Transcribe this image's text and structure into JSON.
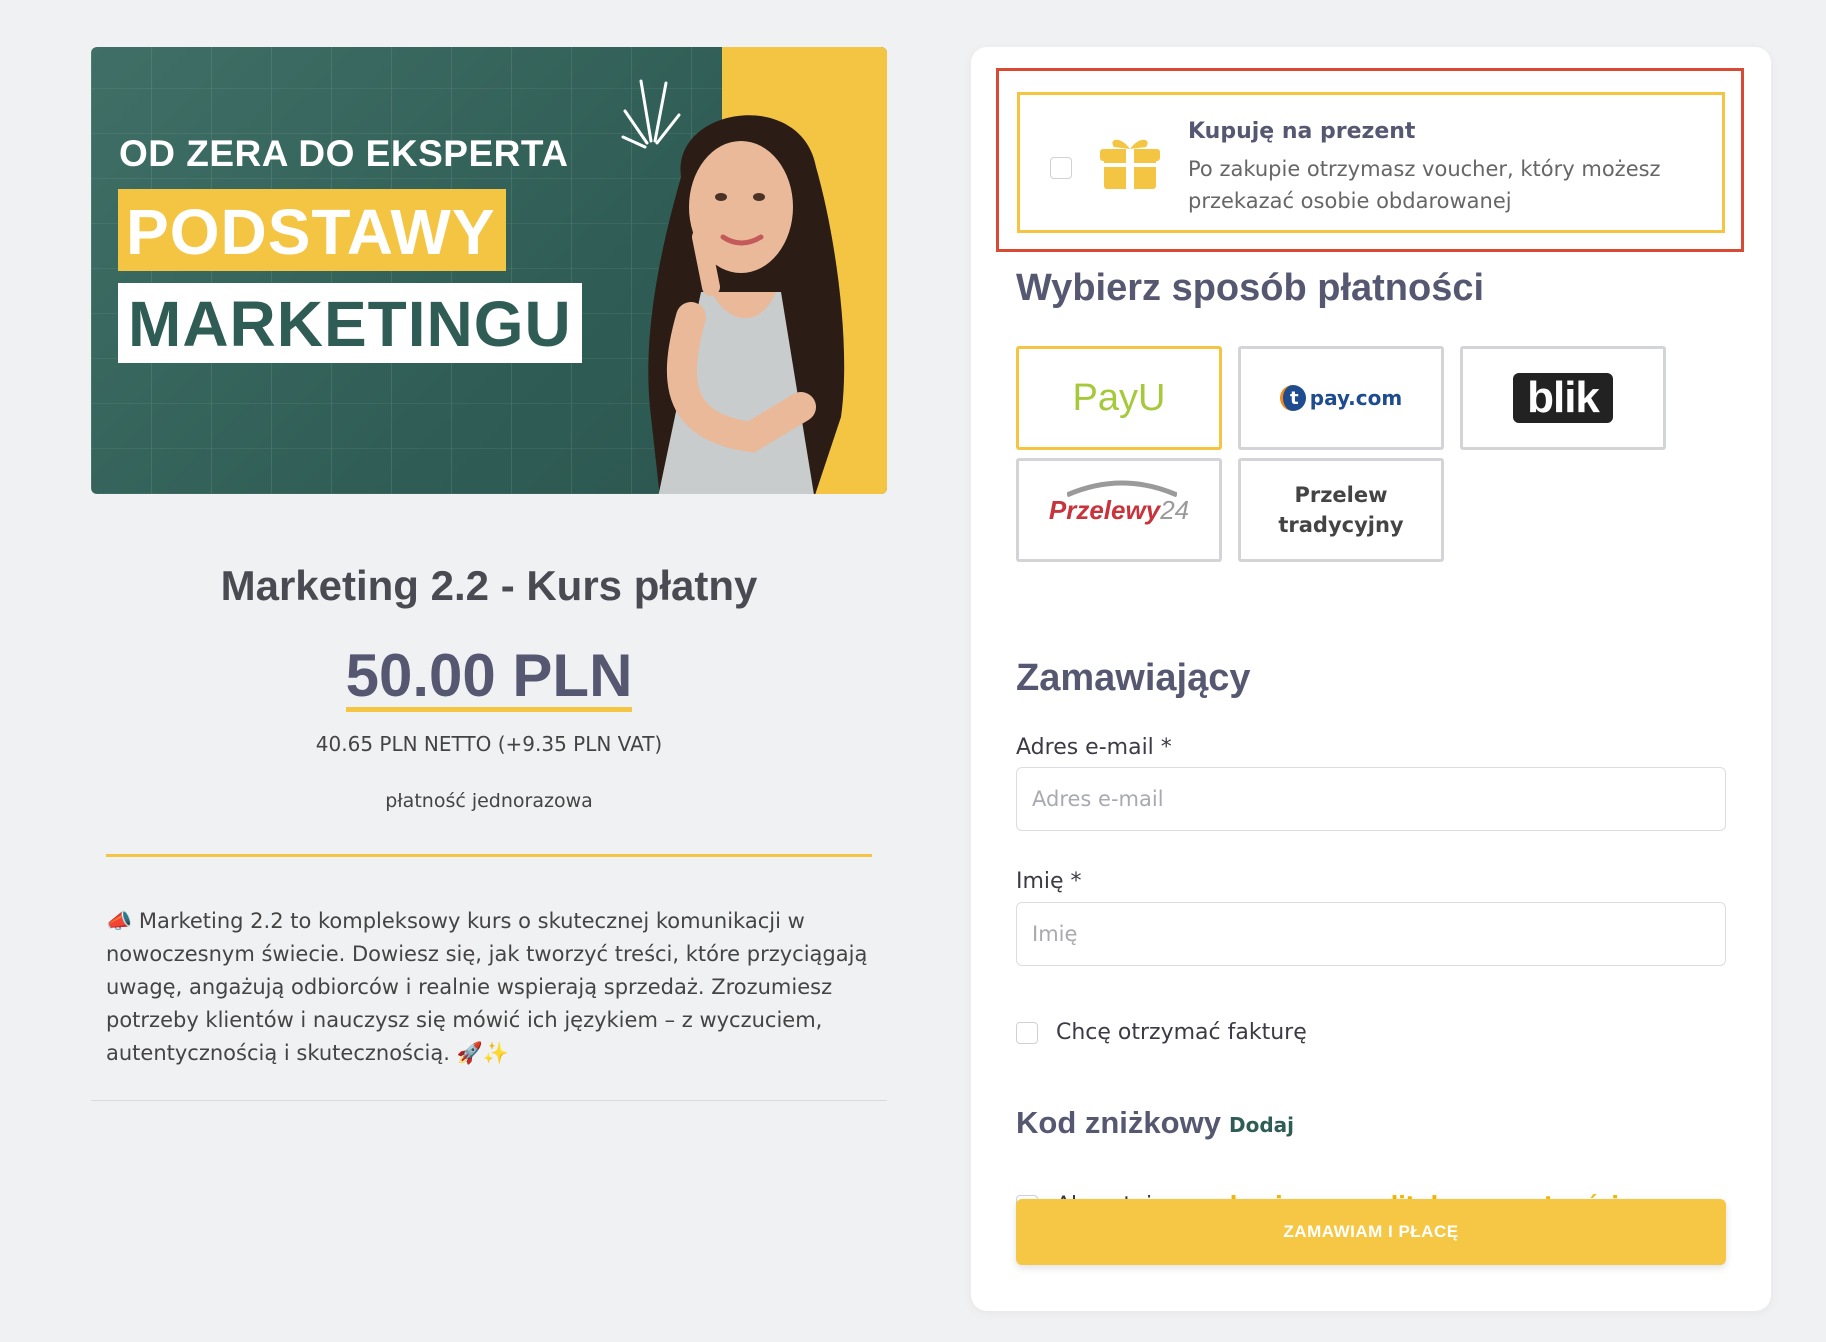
{
  "banner": {
    "kicker": "OD ZERA DO EKSPERTA",
    "title_line1": "PODSTAWY",
    "title_line2": "MARKETINGU"
  },
  "course": {
    "title": "Marketing 2.2 - Kurs płatny",
    "price": "50.00 PLN",
    "netto": "40.65 PLN NETTO (+9.35 PLN VAT)",
    "payment_type": "płatność jednorazowa",
    "description_icon": "📣",
    "description": "Marketing 2.2 to kompleksowy kurs o skutecznej komunikacji w nowoczesnym świecie. Dowiesz się, jak tworzyć treści, które przyciągają uwagę, angażują odbiorców i realnie wspierają sprzedaż. Zrozumiesz potrzeby klientów i nauczysz się mówić ich językiem – z wyczuciem, autentycznością i skutecznością.",
    "description_trailing_icons": "🚀✨"
  },
  "gift": {
    "title": "Kupuję na prezent",
    "text": "Po zakupie otrzymasz voucher, który możesz przekazać osobie obdarowanej",
    "icon": "gift-icon"
  },
  "payment": {
    "heading": "Wybierz sposób płatności",
    "methods": {
      "payu": "PayU",
      "tpay": "pay.com",
      "tpay_t": "t",
      "blik": "blik",
      "p24_a": "Przelewy",
      "p24_b": "24",
      "przelew_line1": "Przelew",
      "przelew_line2": "tradycyjny"
    },
    "selected": "payu"
  },
  "form": {
    "heading": "Zamawiający",
    "email_label": "Adres e-mail *",
    "email_placeholder": "Adres e-mail",
    "name_label": "Imię *",
    "name_placeholder": "Imię",
    "invoice_label": "Chcę otrzymać fakturę",
    "discount_heading": "Kod zniżkowy",
    "discount_add": "Dodaj",
    "terms_pre": "Akceptuję ",
    "terms_link1": "regulamin",
    "terms_mid": " oraz ",
    "terms_link2": "politykę prywatności",
    "submit": "ZAMAWIAM I PŁACĘ"
  },
  "colors": {
    "accent_yellow": "#f4c542",
    "heading": "#565872",
    "teal": "#2f5d55",
    "highlight_red": "#d94a35"
  }
}
